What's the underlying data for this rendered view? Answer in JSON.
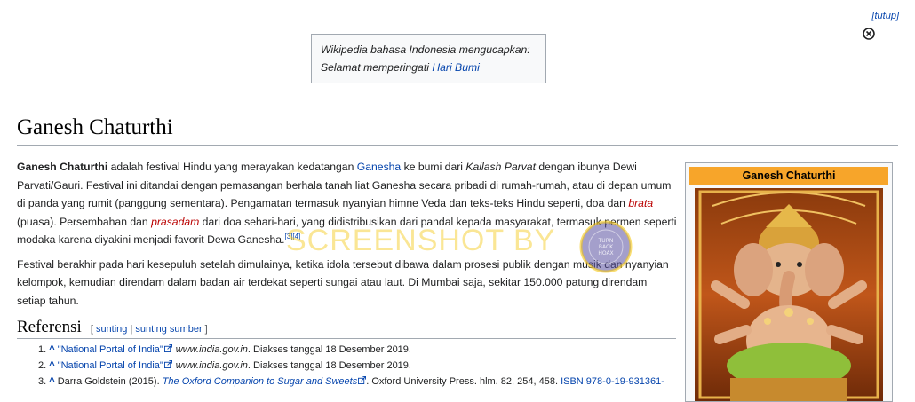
{
  "banner": {
    "hide_label": "[tutup]",
    "line1": "Wikipedia bahasa Indonesia mengucapkan:",
    "line2_prefix": "Selamat memperingati ",
    "line2_link": "Hari Bumi"
  },
  "article": {
    "title": "Ganesh Chaturthi",
    "p1": {
      "bold": "Ganesh Chaturthi",
      "t1": " adalah festival Hindu yang merayakan kedatangan ",
      "link_ganesha": "Ganesha",
      "t2": " ke bumi dari ",
      "italic_kailash": "Kailash Parvat",
      "t3": " dengan ibunya Dewi Parvati/Gauri. Festival ini ditandai dengan pemasangan berhala tanah liat Ganesha secara pribadi di rumah-rumah, atau di depan umum di panda yang rumit (panggung sementara). Pengamatan termasuk nyanyian himne Veda dan teks-teks Hindu seperti, doa dan ",
      "link_brata": "brata",
      "t4": " (puasa). Persembahan dan ",
      "link_prasadam": "prasadam",
      "t5": " dari doa sehari-hari, yang didistribusikan dari pandal kepada masyarakat, termasuk permen seperti modaka karena diyakini menjadi favorit Dewa Ganesha.",
      "sup": "[3][4]"
    },
    "p2": "Festival berakhir pada hari kesepuluh setelah dimulainya, ketika idola tersebut dibawa dalam prosesi publik dengan musik dan nyanyian kelompok, kemudian direndam dalam badan air terdekat seperti sungai atau laut. Di Mumbai saja, sekitar 150.000 patung direndam setiap tahun."
  },
  "references": {
    "heading": "Referensi",
    "edit_open": "[ ",
    "edit_link": "sunting",
    "edit_sep": " | ",
    "edit_source_link": "sunting sumber",
    "edit_close": " ]",
    "items": [
      {
        "num": "1.",
        "caret": "^",
        "title": "\"National Portal of India\"",
        "source": "www.india.gov.in",
        "accessed": ". Diakses tanggal 18 Desember 2019."
      },
      {
        "num": "2.",
        "caret": "^",
        "title": "\"National Portal of India\"",
        "source": "www.india.gov.in",
        "accessed": ". Diakses tanggal 18 Desember 2019."
      },
      {
        "num": "3.",
        "caret": "^",
        "author": "Darra Goldstein (2015). ",
        "title": "The Oxford Companion to Sugar and Sweets",
        "rest": ". Oxford University Press. hlm. 82, 254, 458. ",
        "isbn": "ISBN 978-0-19-931361-"
      }
    ]
  },
  "infobox": {
    "title": "Ganesh Chaturthi"
  },
  "watermark": {
    "text": "SCREENSHOT BY",
    "seal_lines": [
      "TURN",
      "BACK",
      "HOAX"
    ]
  },
  "colors": {
    "link": "#0645ad",
    "redlink": "#ba0000",
    "infobox_header": "#f7a52a",
    "watermark": "#f5c814"
  }
}
